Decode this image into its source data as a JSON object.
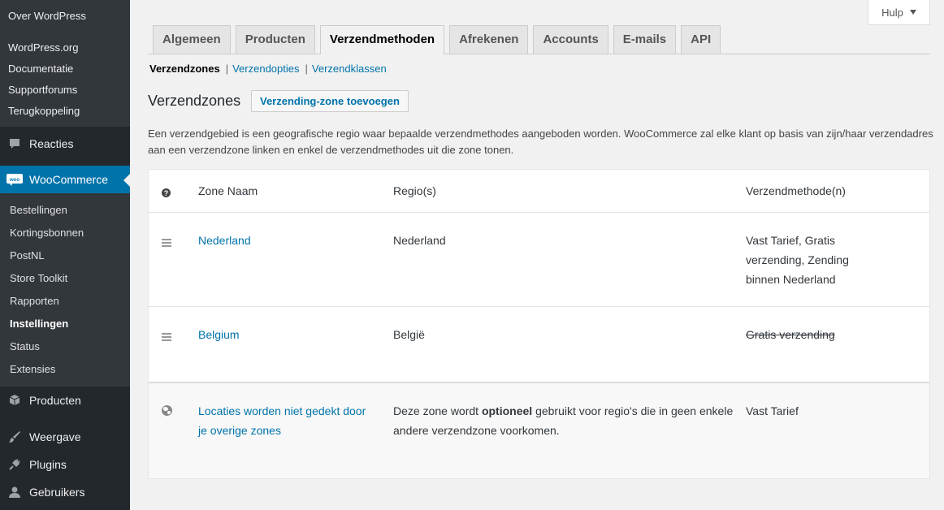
{
  "sidebar": {
    "top_sub": [
      "Over WordPress"
    ],
    "wp_links": [
      "WordPress.org",
      "Documentatie",
      "Supportforums",
      "Terugkoppeling"
    ],
    "menu_reacties": "Reacties",
    "menu_woocommerce": "WooCommerce",
    "woo_items": [
      "Bestellingen",
      "Kortingsbonnen",
      "PostNL",
      "Store Toolkit",
      "Rapporten",
      "Instellingen",
      "Status",
      "Extensies"
    ],
    "menu_producten": "Producten",
    "menu_weergave": "Weergave",
    "menu_plugins": "Plugins",
    "menu_gebruikers": "Gebruikers"
  },
  "header": {
    "help_label": "Hulp"
  },
  "tabs": [
    "Algemeen",
    "Producten",
    "Verzendmethoden",
    "Afrekenen",
    "Accounts",
    "E-mails",
    "API"
  ],
  "active_tab": "Verzendmethoden",
  "subnav": {
    "current": "Verzendzones",
    "links": [
      "Verzendopties",
      "Verzendklassen"
    ],
    "separator": "|"
  },
  "section": {
    "title": "Verzendzones",
    "add_button": "Verzending-zone toevoegen",
    "intro": "Een verzendgebied is een geografische regio waar bepaalde verzendmethodes aangeboden worden. WooCommerce zal elke klant op basis van zijn/haar verzendadres aan een verzendzone linken en enkel de verzendmethodes uit die zone tonen."
  },
  "table": {
    "help_glyph": "?",
    "headers": {
      "name": "Zone Naam",
      "regions": "Regio(s)",
      "methods": "Verzendmethode(n)"
    },
    "rows": [
      {
        "name": "Nederland",
        "regions": "Nederland",
        "methods": "Vast Tarief, Gratis verzending, Zending binnen Nederland",
        "disabled": false
      },
      {
        "name": "Belgium",
        "regions": "België",
        "methods": "Gratis verzending",
        "disabled": true
      }
    ],
    "rest": {
      "name": "Locaties worden niet gedekt door je overige zones",
      "regions_pre": "Deze zone wordt ",
      "regions_bold": "optioneel",
      "regions_post": " gebruikt voor regio's die in geen enkele andere verzendzone voorkomen.",
      "methods": "Vast Tarief"
    }
  },
  "colors": {
    "accent": "#0073aa",
    "sidebar_bg": "#23282d",
    "submenu_bg": "#32373c"
  }
}
